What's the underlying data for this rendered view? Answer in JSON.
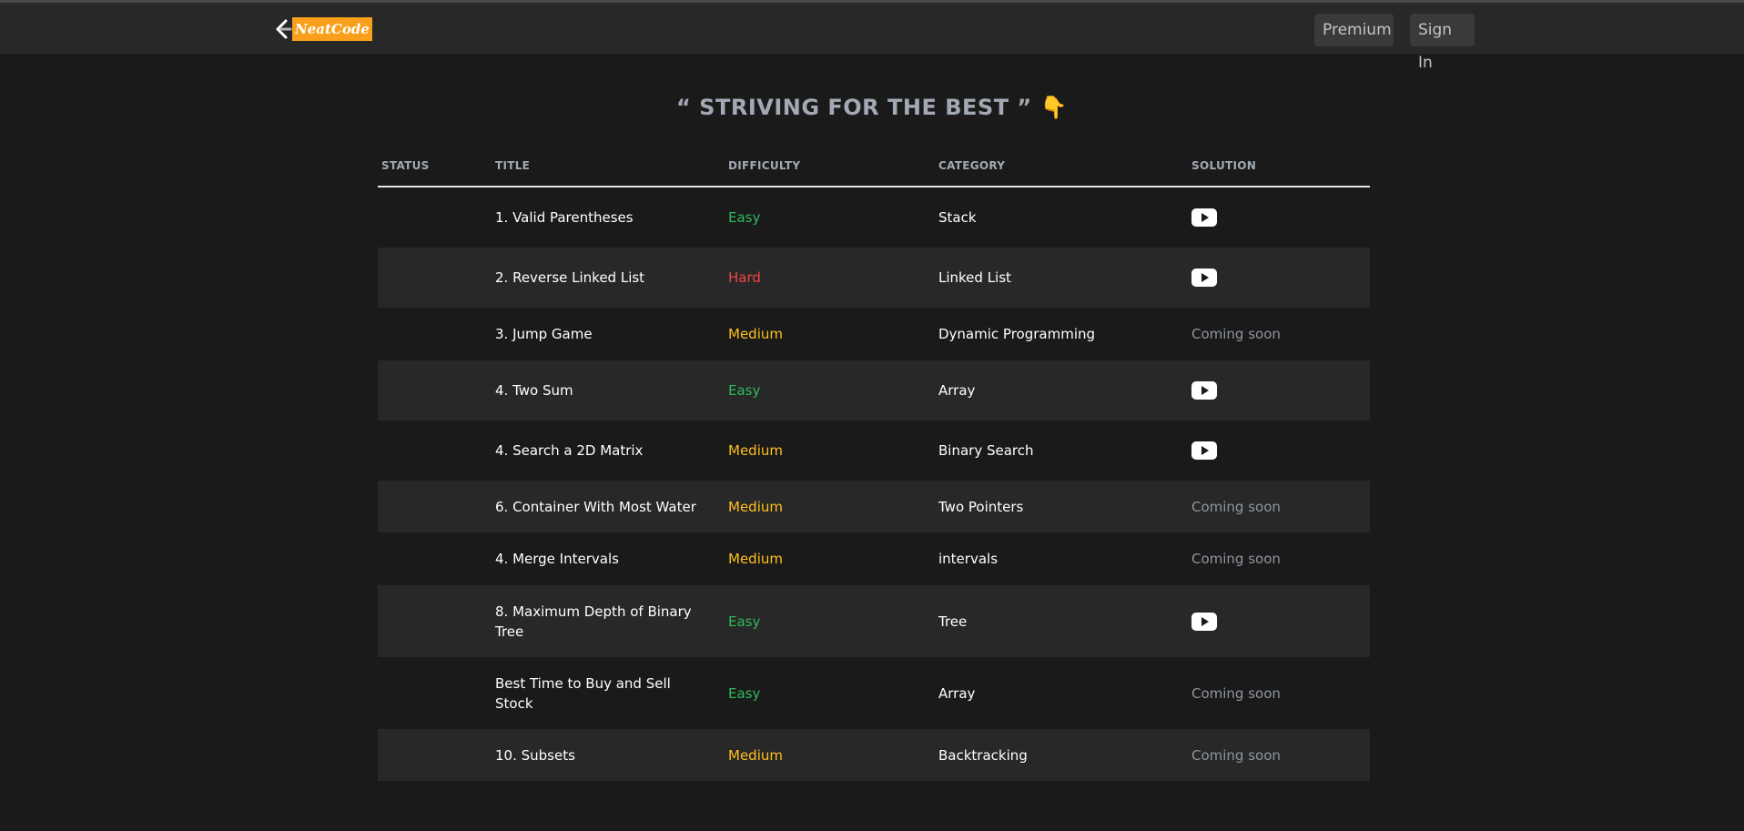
{
  "brand": {
    "logo_text": "NeatCode"
  },
  "nav": {
    "premium_label": "Premium",
    "signin_label": "Sign In"
  },
  "tagline": "“ STRIVING FOR THE BEST ” 👇",
  "table": {
    "headers": {
      "status": "STATUS",
      "title": "TITLE",
      "difficulty": "DIFFICULTY",
      "category": "CATEGORY",
      "solution": "SOLUTION"
    },
    "rows": [
      {
        "title": "1. Valid Parentheses",
        "difficulty": "Easy",
        "category": "Stack",
        "solution": "video-icon"
      },
      {
        "title": "2. Reverse Linked List",
        "difficulty": "Hard",
        "category": "Linked List",
        "solution": "video-icon"
      },
      {
        "title": "3. Jump Game",
        "difficulty": "Medium",
        "category": "Dynamic Programming",
        "solution": "Coming soon"
      },
      {
        "title": "4. Two Sum",
        "difficulty": "Easy",
        "category": "Array",
        "solution": "video-icon"
      },
      {
        "title": "4. Search a 2D Matrix",
        "difficulty": "Medium",
        "category": "Binary Search",
        "solution": "video-icon"
      },
      {
        "title": "6. Container With Most Water",
        "difficulty": "Medium",
        "category": "Two Pointers",
        "solution": "Coming soon"
      },
      {
        "title": "4. Merge Intervals",
        "difficulty": "Medium",
        "category": "intervals",
        "solution": "Coming soon"
      },
      {
        "title": "8. Maximum Depth of Binary Tree",
        "difficulty": "Easy",
        "category": "Tree",
        "solution": "video-icon"
      },
      {
        "title": "Best Time to Buy and Sell Stock",
        "difficulty": "Easy",
        "category": "Array",
        "solution": "Coming soon"
      },
      {
        "title": "10. Subsets",
        "difficulty": "Medium",
        "category": "Backtracking",
        "solution": "Coming soon"
      }
    ]
  },
  "colors": {
    "background": "#1a1a1a",
    "navbar": "#282828",
    "alt_row": "#282828",
    "easy": "#2cbb5d",
    "medium": "#ffc01e",
    "hard": "#ef4743",
    "brand_orange": "#f89f1b"
  }
}
